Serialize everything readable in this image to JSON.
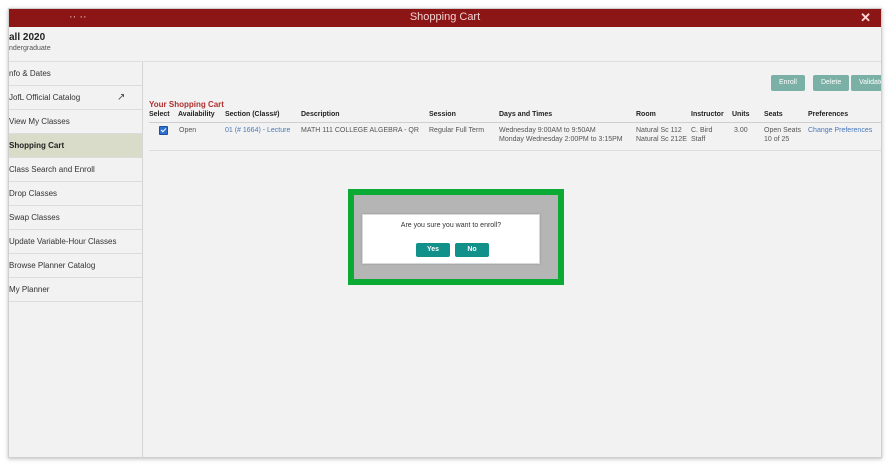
{
  "window": {
    "title": "Shopping Cart",
    "close_glyph": "✕",
    "title_dots": "·· ··"
  },
  "term": {
    "name": "all 2020",
    "career": "ndergraduate"
  },
  "sidebar": {
    "items": [
      {
        "label": "nfo & Dates"
      },
      {
        "label": "JofL Official Catalog",
        "icon": "external-link-icon"
      },
      {
        "label": "View My Classes"
      },
      {
        "label": "Shopping Cart",
        "active": true
      },
      {
        "label": "Class Search and Enroll"
      },
      {
        "label": "Drop Classes"
      },
      {
        "label": "Swap Classes"
      },
      {
        "label": "Update Variable-Hour Classes"
      },
      {
        "label": "Browse Planner Catalog"
      },
      {
        "label": "My Planner"
      }
    ]
  },
  "actions": {
    "enroll": "Enroll",
    "delete": "Delete",
    "validate": "Validate"
  },
  "cart": {
    "title": "Your Shopping Cart",
    "columns": [
      "Select",
      "Availability",
      "Section (Class#)",
      "Description",
      "Session",
      "Days and Times",
      "Room",
      "Instructor",
      "Units",
      "Seats",
      "Preferences"
    ],
    "row": {
      "selected": true,
      "availability": "Open",
      "section": "01 (# 1664) - Lecture",
      "description": "MATH 111 COLLEGE ALGEBRA - QR",
      "session": "Regular Full Term",
      "days_1": "Wednesday  9:00AM to 9:50AM",
      "days_2": "Monday Wednesday  2:00PM to 3:15PM",
      "room_1": "Natural Sc 112",
      "room_2": "Natural Sc 212E",
      "instructor_1": "C. Bird",
      "instructor_2": "Staff",
      "units": "3.00",
      "seats_1": "Open Seats",
      "seats_2": "10 of 25",
      "preferences": "Change Preferences"
    }
  },
  "dialog": {
    "message": "Are you sure you want to enroll?",
    "yes": "Yes",
    "no": "No"
  },
  "colors": {
    "titlebar": "#8c1515",
    "accent": "#12918a",
    "highlight": "#0aaa35",
    "link": "#4a78b8"
  }
}
